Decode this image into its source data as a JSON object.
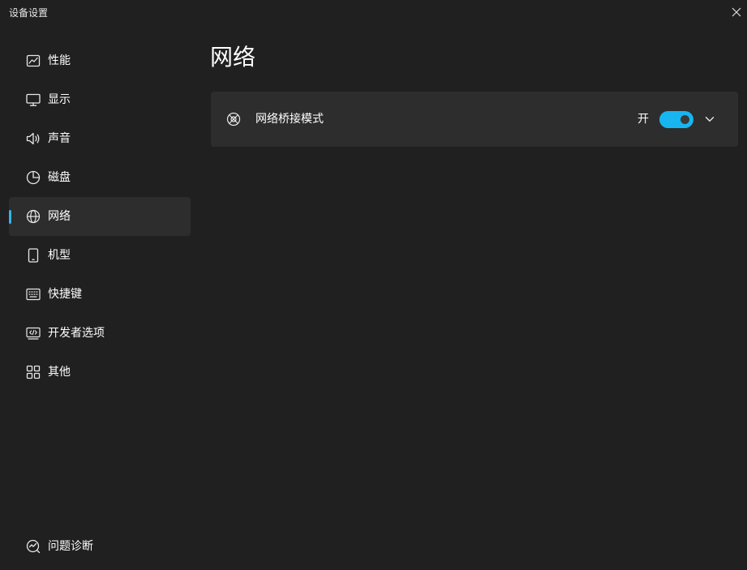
{
  "window": {
    "title": "设备设置",
    "close_icon": "close-icon"
  },
  "sidebar": {
    "items": [
      {
        "label": "性能",
        "icon": "performance-chart-icon",
        "active": false
      },
      {
        "label": "显示",
        "icon": "monitor-icon",
        "active": false
      },
      {
        "label": "声音",
        "icon": "speaker-icon",
        "active": false
      },
      {
        "label": "磁盘",
        "icon": "pie-chart-icon",
        "active": false
      },
      {
        "label": "网络",
        "icon": "globe-icon",
        "active": true
      },
      {
        "label": "机型",
        "icon": "phone-icon",
        "active": false
      },
      {
        "label": "快捷键",
        "icon": "keyboard-icon",
        "active": false
      },
      {
        "label": "开发者选项",
        "icon": "code-icon",
        "active": false
      },
      {
        "label": "其他",
        "icon": "grid-icon",
        "active": false
      }
    ],
    "bottom": {
      "label": "问题诊断",
      "icon": "diagnose-icon"
    }
  },
  "main": {
    "title": "网络",
    "settings": [
      {
        "label": "网络桥接模式",
        "icon": "bridge-icon",
        "state_label": "开",
        "enabled": true,
        "expand_icon": "chevron-down-icon"
      }
    ]
  },
  "colors": {
    "accent": "#36b4e8",
    "toggle_on": "#18b6f0",
    "background": "#202020",
    "card": "#2d2d2d"
  }
}
